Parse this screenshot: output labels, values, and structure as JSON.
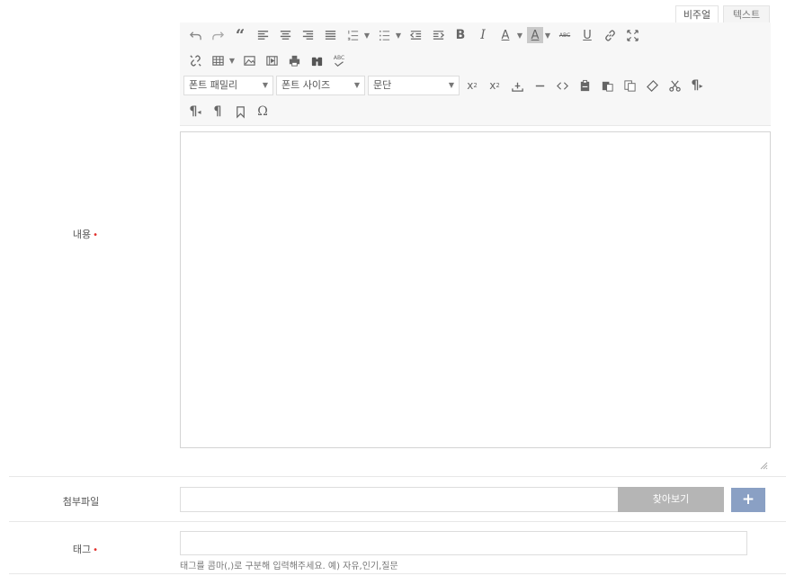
{
  "editor_tabs": {
    "visual": "비주얼",
    "text": "텍스트"
  },
  "toolbar": {
    "row1_icons": [
      "undo-icon",
      "redo-icon",
      "blockquote-icon",
      "align-left-icon",
      "align-center-icon",
      "align-right-icon",
      "align-justify-icon",
      "ordered-list-icon",
      "unordered-list-icon",
      "outdent-icon",
      "indent-icon",
      "bold-icon",
      "italic-icon",
      "text-color-icon",
      "background-color-icon",
      "strikethrough-icon",
      "underline-icon",
      "link-icon",
      "fullscreen-icon"
    ],
    "row2_icons": [
      "unlink-icon",
      "table-icon",
      "image-icon",
      "media-icon",
      "print-icon",
      "find-icon",
      "spellcheck-icon"
    ],
    "font_family": "폰트 패밀리",
    "font_size": "폰트 사이즈",
    "paragraph": "문단",
    "row3_icons": [
      "superscript-icon",
      "subscript-icon",
      "anchor-icon",
      "horizontal-rule-icon",
      "code-icon",
      "paste-icon",
      "paste-text-icon",
      "copy-icon",
      "eraser-icon",
      "cut-icon",
      "ltr-icon"
    ],
    "row4_icons": [
      "rtl-icon",
      "pilcrow-icon",
      "bookmark-icon",
      "omega-icon"
    ],
    "glyphs": {
      "quote": "“",
      "bold": "B",
      "italic": "I",
      "underline": "U",
      "textcolor": "A",
      "omega": "Ω",
      "pilcrow": "¶",
      "abc": "ABC",
      "strike": "ABC"
    }
  },
  "form": {
    "content_label": "내용",
    "attach_label": "첨부파일",
    "find_button": "찾아보기",
    "add_button": "+",
    "tag_label": "태그",
    "required_mark": "•",
    "tag_placeholder": "",
    "tag_hint": "태그를 콤마(,)로 구분해 입력해주세요. 예) 자유,인기,질문"
  },
  "colors": {
    "find_button": "#b5b5b5",
    "add_button": "#8aa0c4",
    "required": "#e2302c"
  }
}
